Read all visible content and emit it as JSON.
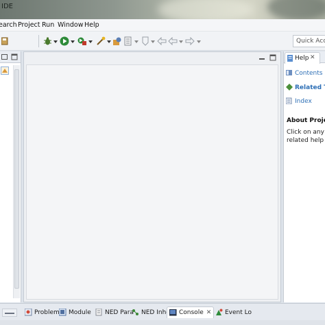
{
  "window": {
    "title": "IDE"
  },
  "menu": {
    "items": [
      "earch",
      "Project",
      "Run",
      "Window",
      "Help"
    ]
  },
  "toolbar": {
    "quick_access_placeholder": "Quick Access"
  },
  "help_view": {
    "tab_label": "Help",
    "links": [
      "Contents",
      "Related To",
      "Index"
    ],
    "section_title": "About Project E",
    "description_lines": [
      "Click on any wo",
      "related help top"
    ]
  },
  "bottom_tabs": [
    {
      "label": "Problem",
      "icon": "problems-icon"
    },
    {
      "label": "Module",
      "icon": "module-icon"
    },
    {
      "label": "NED Para",
      "icon": "ned-parameters-icon"
    },
    {
      "label": "NED Inhe",
      "icon": "ned-inheritance-icon"
    },
    {
      "label": "Console",
      "icon": "console-icon",
      "active": true
    },
    {
      "label": "Event Lo",
      "icon": "event-log-icon"
    }
  ],
  "colors": {
    "link": "#2d6fb6",
    "accent_green": "#2e8b3a",
    "view_header": "#e9edf3"
  }
}
